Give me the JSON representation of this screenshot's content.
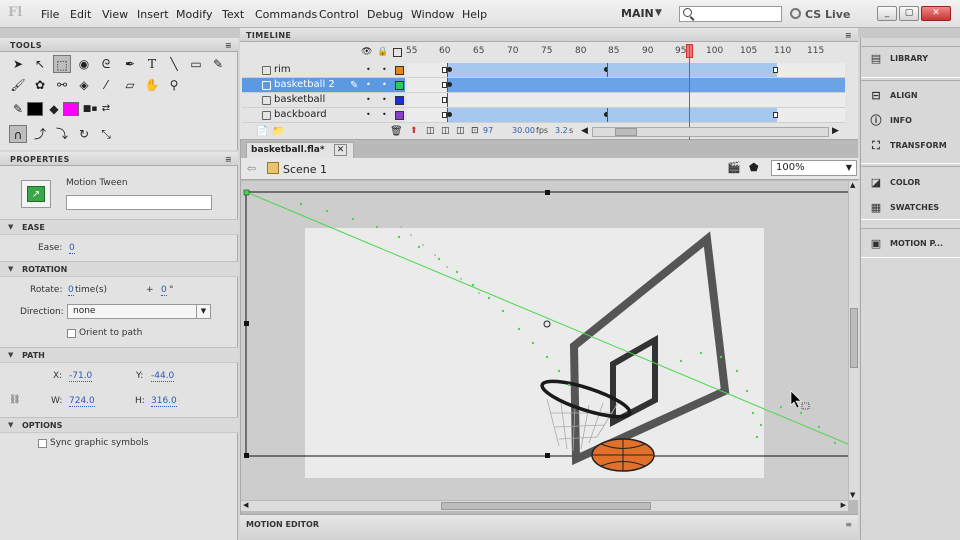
{
  "menubar": {
    "logo": "Fl",
    "items": [
      "File",
      "Edit",
      "View",
      "Insert",
      "Modify",
      "Text",
      "Commands",
      "Control",
      "Debug",
      "Window",
      "Help"
    ],
    "workspace": "MAIN",
    "search_placeholder": "",
    "cs_live": "CS Live",
    "window_controls": [
      "_",
      "▢",
      "✕"
    ]
  },
  "tools_panel": {
    "title": "TOOLS"
  },
  "properties_panel": {
    "title": "PROPERTIES",
    "instance_type": "Motion Tween",
    "instance_name": "",
    "sections": {
      "ease": {
        "title": "EASE",
        "ease_label": "Ease:",
        "ease_value": "0"
      },
      "rotation": {
        "title": "ROTATION",
        "rotate_label": "Rotate:",
        "rotate_times": "0",
        "times_suffix": "time(s)",
        "plus": "+",
        "degrees": "0",
        "degree_sign": "°",
        "direction_label": "Direction:",
        "direction_value": "none",
        "orient_label": "Orient to path"
      },
      "path": {
        "title": "PATH",
        "x_label": "X:",
        "x_value": "-71.0",
        "y_label": "Y:",
        "y_value": "-44.0",
        "w_label": "W:",
        "w_value": "724.0",
        "h_label": "H:",
        "h_value": "316.0"
      },
      "options": {
        "title": "OPTIONS",
        "sync_label": "Sync graphic symbols"
      }
    }
  },
  "timeline": {
    "title": "TIMELINE",
    "frame_numbers": [
      "55",
      "60",
      "65",
      "70",
      "75",
      "80",
      "85",
      "90",
      "95",
      "100",
      "105",
      "110",
      "115"
    ],
    "layers": [
      {
        "name": "rim",
        "color": "#e08a1e"
      },
      {
        "name": "basketball 2",
        "color": "#2bcc5a",
        "selected": true
      },
      {
        "name": "basketball",
        "color": "#1d2ed6"
      },
      {
        "name": "backboard",
        "color": "#8a3fc7"
      }
    ],
    "status": {
      "frame": "97",
      "fps": "30.00",
      "fps_unit": "fps",
      "time": "3.2",
      "time_unit": "s"
    }
  },
  "document": {
    "tab": "basketball.fla*",
    "scene": "Scene 1",
    "zoom": "100%"
  },
  "motion_editor": {
    "title": "MOTION EDITOR"
  },
  "dock": {
    "items": [
      {
        "label": "LIBRARY",
        "icon": "library-icon"
      },
      {
        "label": "ALIGN",
        "icon": "align-icon"
      },
      {
        "label": "INFO",
        "icon": "info-icon"
      },
      {
        "label": "TRANSFORM",
        "icon": "transform-icon"
      },
      {
        "label": "COLOR",
        "icon": "color-icon"
      },
      {
        "label": "SWATCHES",
        "icon": "swatches-icon"
      },
      {
        "label": "MOTION P...",
        "icon": "motion-presets-icon"
      }
    ]
  },
  "colors": {
    "selected_layer": "#5b99e0",
    "tween_span": "#a6c8ee",
    "playhead": "#e23b3b",
    "motion_path": "#4cd64c",
    "fill_swatch": "#ff00ff",
    "stroke_swatch": "#000000"
  }
}
